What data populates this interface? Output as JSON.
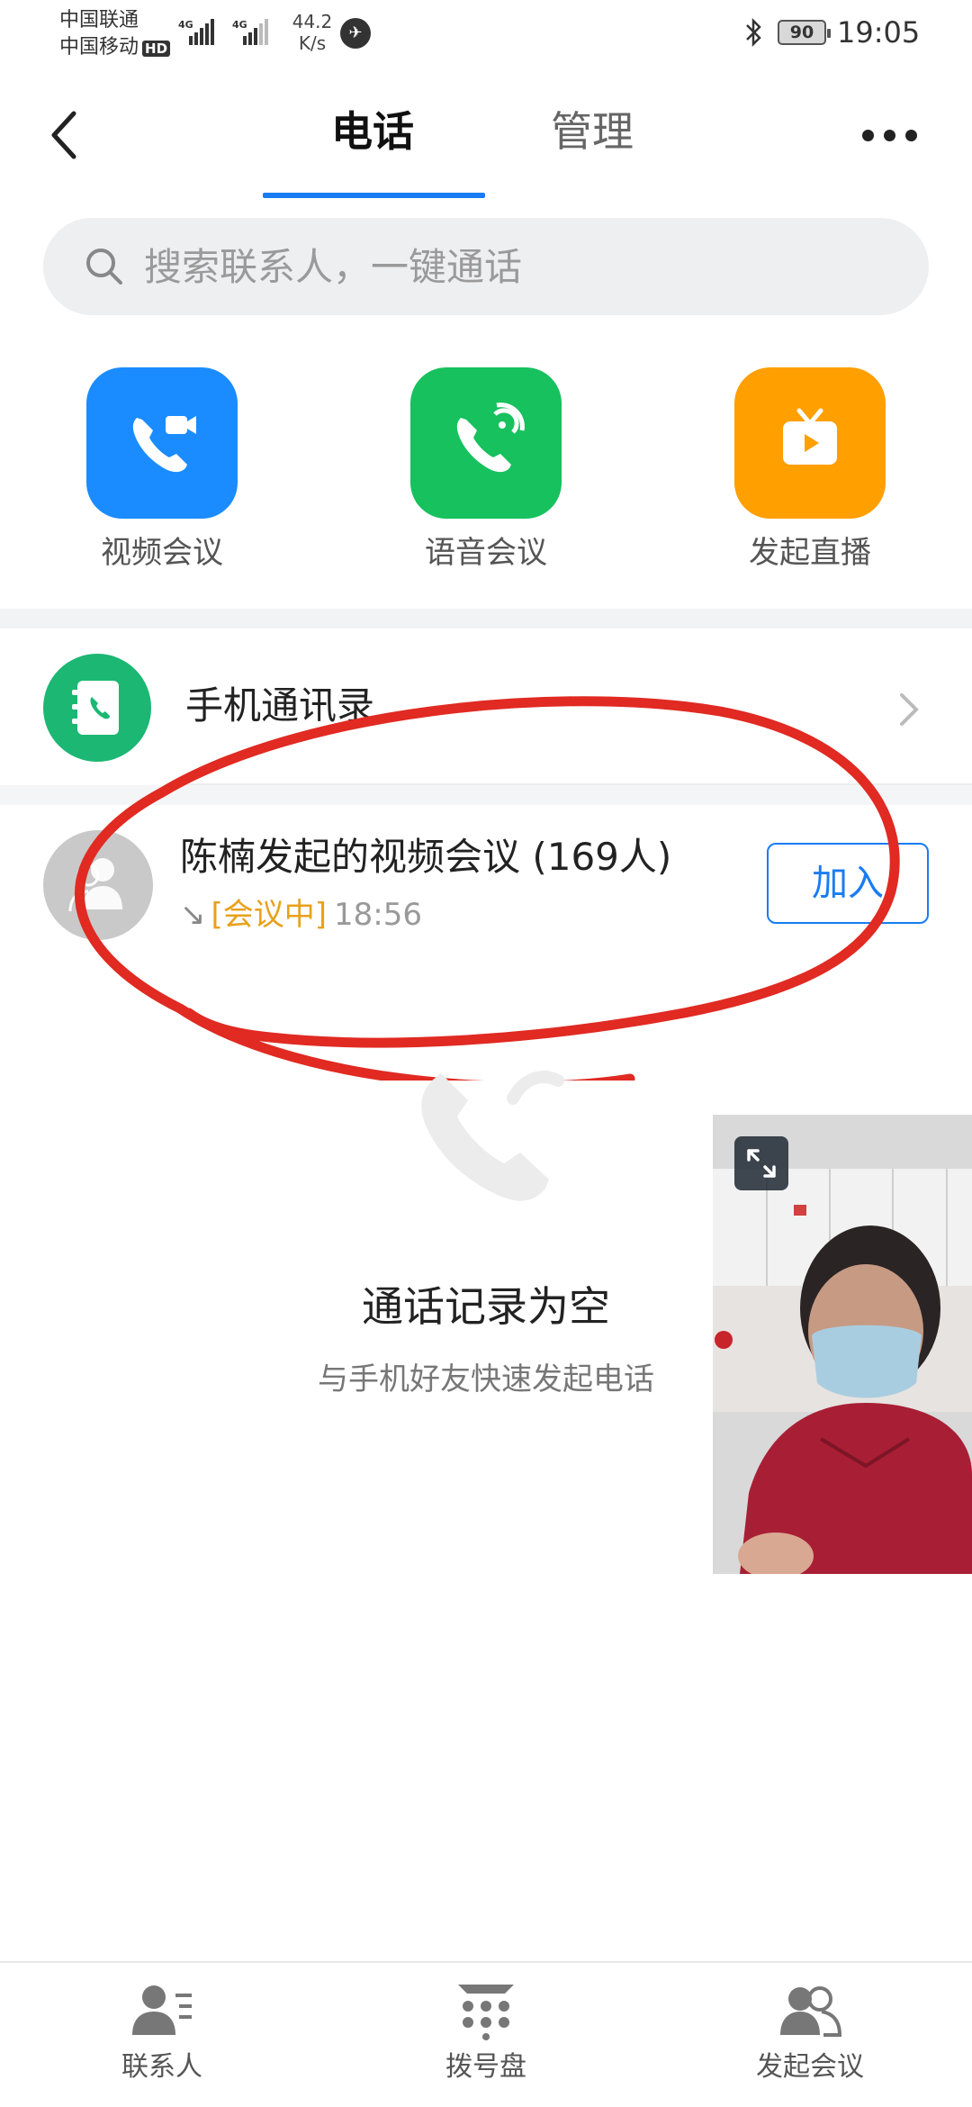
{
  "status_bar": {
    "carrier_1": "中国联通",
    "carrier_2": "中国移动",
    "hd_badge": "HD",
    "signal_1": "4G",
    "signal_2": "4G",
    "net_speed_value": "44.2",
    "net_speed_unit": "K/s",
    "battery": "90",
    "time": "19:05"
  },
  "header": {
    "tabs": [
      {
        "label": "电话",
        "active": true
      },
      {
        "label": "管理",
        "active": false
      }
    ]
  },
  "search": {
    "placeholder": "搜索联系人，一键通话"
  },
  "quick_actions": [
    {
      "label": "视频会议",
      "icon": "video-call-icon",
      "color": "#1a8cff"
    },
    {
      "label": "语音会议",
      "icon": "voice-call-icon",
      "color": "#16c15e"
    },
    {
      "label": "发起直播",
      "icon": "live-tv-icon",
      "color": "#ff9f00"
    }
  ],
  "contacts_row": {
    "label": "手机通讯录",
    "icon": "address-book-icon",
    "color": "#1cb773"
  },
  "meeting": {
    "title": "陈楠发起的视频会议 (169人)",
    "direction_icon": "↘",
    "status": "[会议中]",
    "time": "18:56",
    "join_label": "加入",
    "status_color": "#e8a11a"
  },
  "empty_state": {
    "title": "通话记录为空",
    "subtitle": "与手机好友快速发起电话"
  },
  "bottom_nav": [
    {
      "label": "联系人",
      "icon": "contacts-icon"
    },
    {
      "label": "拨号盘",
      "icon": "dialpad-icon"
    },
    {
      "label": "发起会议",
      "icon": "start-meeting-icon"
    }
  ],
  "accent_color": "#1a7cf2",
  "annotation_color": "#e02a22"
}
